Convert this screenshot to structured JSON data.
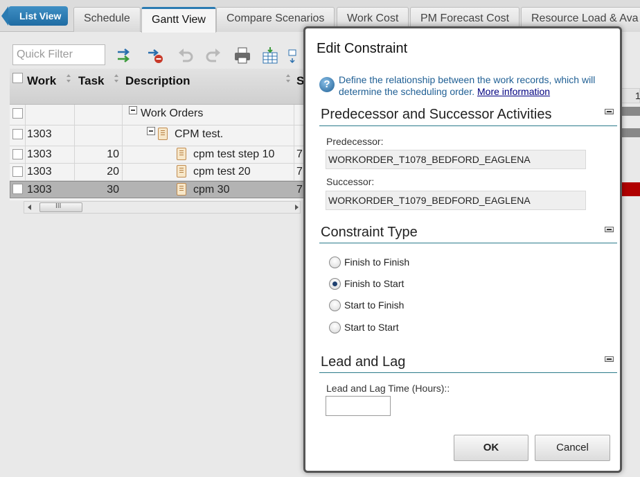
{
  "nav": {
    "list_view": "List View"
  },
  "tabs": [
    {
      "label": "Schedule"
    },
    {
      "label": "Gantt View"
    },
    {
      "label": "Compare Scenarios"
    },
    {
      "label": "Work Cost"
    },
    {
      "label": "PM Forecast Cost"
    },
    {
      "label": "Resource Load & Ava"
    }
  ],
  "toolbar": {
    "quick_filter_placeholder": "Quick Filter"
  },
  "grid": {
    "columns": [
      "Work",
      "Task",
      "Description",
      "S"
    ],
    "rows": [
      {
        "work": "",
        "task": "",
        "description": "Work Orders",
        "s": ""
      },
      {
        "work": "1303",
        "task": "",
        "description": "CPM test.",
        "s": ""
      },
      {
        "work": "1303",
        "task": "10",
        "description": "cpm test step 10",
        "s": "7"
      },
      {
        "work": "1303",
        "task": "20",
        "description": "cpm test 20",
        "s": "7"
      },
      {
        "work": "1303",
        "task": "30",
        "description": "cpm 30",
        "s": "7"
      }
    ],
    "scrollbar_grip": "III"
  },
  "gantt_peek": {
    "label": "1"
  },
  "dialog": {
    "title": "Edit Constraint",
    "info": "Define the relationship between the work records, which will determine the scheduling order.",
    "more_info": "More information",
    "sections": {
      "activities": "Predecessor and Successor Activities",
      "constraint_type": "Constraint Type",
      "lead_lag": "Lead and Lag"
    },
    "predecessor_label": "Predecessor:",
    "predecessor_value": "WORKORDER_T1078_BEDFORD_EAGLENA",
    "successor_label": "Successor:",
    "successor_value": "WORKORDER_T1079_BEDFORD_EAGLENA",
    "constraint_options": [
      {
        "label": "Finish to Finish",
        "checked": false
      },
      {
        "label": "Finish to Start",
        "checked": true
      },
      {
        "label": "Start to Finish",
        "checked": false
      },
      {
        "label": "Start to Start",
        "checked": false
      }
    ],
    "lag_label": "Lead and Lag Time (Hours)::",
    "lag_value": "",
    "ok": "OK",
    "cancel": "Cancel"
  }
}
